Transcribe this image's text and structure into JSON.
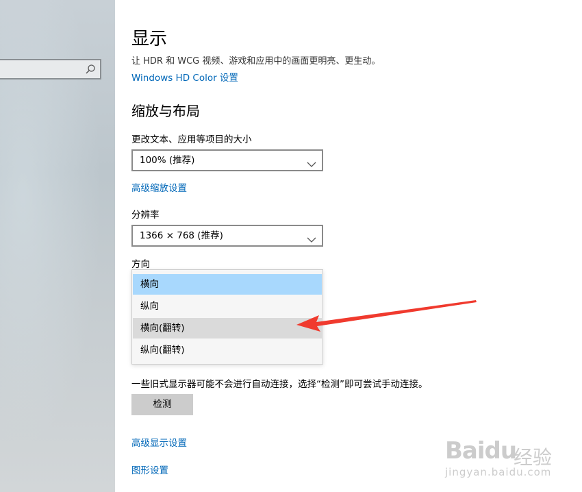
{
  "sidebar": {
    "search_placeholder": ""
  },
  "display": {
    "title": "显示",
    "subtitle": "让 HDR 和 WCG 视频、游戏和应用中的画面更明亮、更生动。",
    "hdr_link": "Windows HD Color 设置"
  },
  "scale_layout": {
    "section_title": "缩放与布局",
    "scale_label": "更改文本、应用等项目的大小",
    "scale_value": "100% (推荐)",
    "advanced_scale_link": "高级缩放设置",
    "resolution_label": "分辨率",
    "resolution_value": "1366 × 768 (推荐)",
    "orientation_label": "方向",
    "orientation_options": [
      {
        "label": "横向",
        "state": "selected"
      },
      {
        "label": "纵向",
        "state": "normal"
      },
      {
        "label": "横向(翻转)",
        "state": "hover"
      },
      {
        "label": "纵向(翻转)",
        "state": "normal"
      }
    ]
  },
  "detect": {
    "note": "一些旧式显示器可能不会进行自动连接，选择“检测”即可尝试手动连接。",
    "button_label": "检测"
  },
  "links": {
    "advanced_display": "高级显示设置",
    "graphics": "图形设置"
  },
  "annotation": {
    "arrow_color": "#f03a2e"
  },
  "watermark": {
    "logo": "Baidu",
    "cn": "经验",
    "url": "jingyan.baidu.com"
  },
  "colors": {
    "accent_link": "#0067b8",
    "selected_option": "#a8d8fd",
    "hover_option": "#dadada",
    "button_bg": "#cccccc"
  }
}
